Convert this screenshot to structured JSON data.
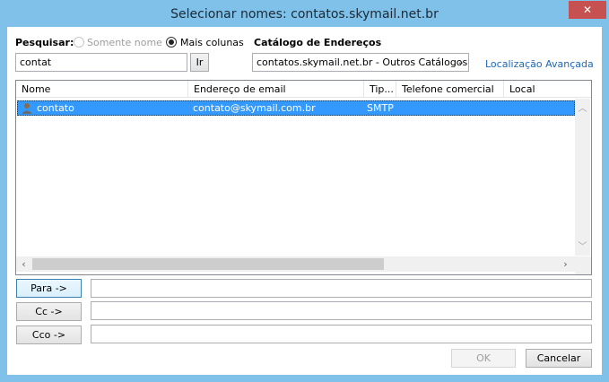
{
  "window": {
    "title": "Selecionar nomes: contatos.skymail.net.br",
    "close_glyph": "✕"
  },
  "search": {
    "label": "Pesquisar:",
    "option_name_only": "Somente nome",
    "option_more_columns": "Mais colunas",
    "query": "contat",
    "go_label": "Ir"
  },
  "address_book": {
    "label": "Catálogo de Endereços",
    "selected": "contatos.skymail.net.br - Outros Catálogos",
    "advanced_link": "Localização Avançada"
  },
  "list": {
    "columns": [
      "Nome",
      "Endereço de email",
      "Tip...",
      "Telefone comercial",
      "Local"
    ],
    "rows": [
      {
        "name": "contato",
        "email": "contato@skymail.com.br",
        "type": "SMTP",
        "phone": "",
        "location": ""
      }
    ]
  },
  "recipients": {
    "to_label": "Para ->",
    "cc_label": "Cc ->",
    "bcc_label": "Cco ->",
    "to_value": "",
    "cc_value": "",
    "bcc_value": ""
  },
  "footer": {
    "ok_label": "OK",
    "cancel_label": "Cancelar"
  },
  "icons": {
    "close": "close-icon",
    "dropdown": "chevron-down-icon",
    "contact": "person-icon",
    "scroll_up": "chevron-up-icon",
    "scroll_down": "chevron-down-icon",
    "scroll_left": "chevron-left-icon",
    "scroll_right": "chevron-right-icon"
  },
  "colors": {
    "titlebar": "#7fc1e8",
    "selection": "#3399ff",
    "close_button": "#c75050",
    "link": "#1f68b5"
  }
}
